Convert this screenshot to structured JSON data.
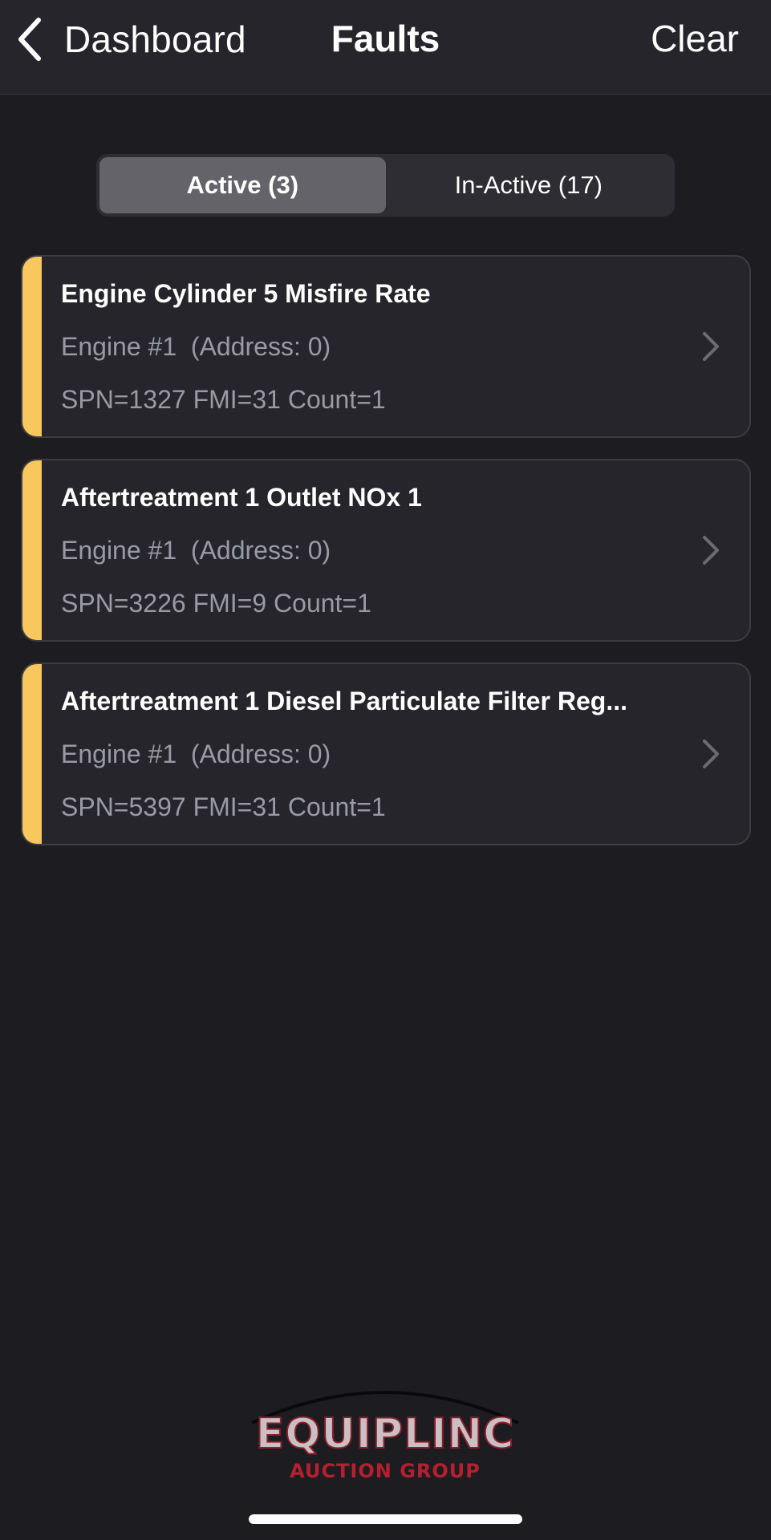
{
  "navbar": {
    "back_label": "Dashboard",
    "title": "Faults",
    "clear_label": "Clear"
  },
  "tabs": [
    {
      "label": "Active (3)",
      "selected": true
    },
    {
      "label": "In-Active (17)",
      "selected": false
    }
  ],
  "faults": [
    {
      "title": "Engine Cylinder 5 Misfire Rate",
      "source": "Engine #1  (Address: 0)",
      "codes": "SPN=1327 FMI=31 Count=1"
    },
    {
      "title": "Aftertreatment 1 Outlet NOx 1",
      "source": "Engine #1  (Address: 0)",
      "codes": "SPN=3226 FMI=9 Count=1"
    },
    {
      "title": "Aftertreatment 1 Diesel Particulate Filter Reg...",
      "source": "Engine #1  (Address: 0)",
      "codes": "SPN=5397 FMI=31 Count=1"
    }
  ],
  "logo": {
    "word": "EQUIPLINC",
    "sub": "AUCTION GROUP"
  },
  "colors": {
    "background": "#1c1c21",
    "severity_active": "#f8c75d",
    "secondary_text": "#9a9aa2"
  }
}
